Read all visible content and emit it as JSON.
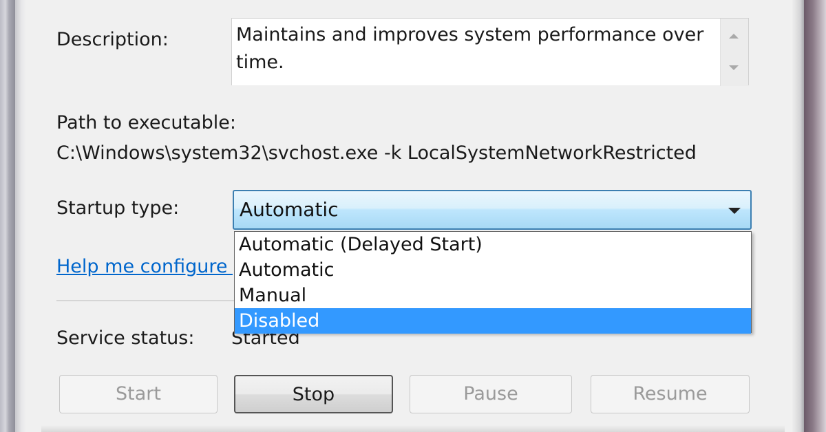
{
  "description": {
    "label": "Description:",
    "text": "Maintains and improves system performance over time."
  },
  "path": {
    "label": "Path to executable:",
    "value": "C:\\Windows\\system32\\svchost.exe -k LocalSystemNetworkRestricted"
  },
  "startup": {
    "label": "Startup type:",
    "selected": "Automatic",
    "options": [
      "Automatic (Delayed Start)",
      "Automatic",
      "Manual",
      "Disabled"
    ],
    "highlighted_option": "Disabled"
  },
  "help_link": {
    "label": "Help me configure s"
  },
  "service_status": {
    "label": "Service status:",
    "value": "Started"
  },
  "buttons": {
    "start": "Start",
    "stop": "Stop",
    "pause": "Pause",
    "resume": "Resume"
  },
  "colors": {
    "selection": "#3399ff",
    "link": "#0066cc",
    "combo_border": "#3c7fb1"
  },
  "icons": {
    "scroll_up": "triangle-up-icon",
    "scroll_down": "triangle-down-icon",
    "combo_dropdown": "triangle-down-icon"
  }
}
